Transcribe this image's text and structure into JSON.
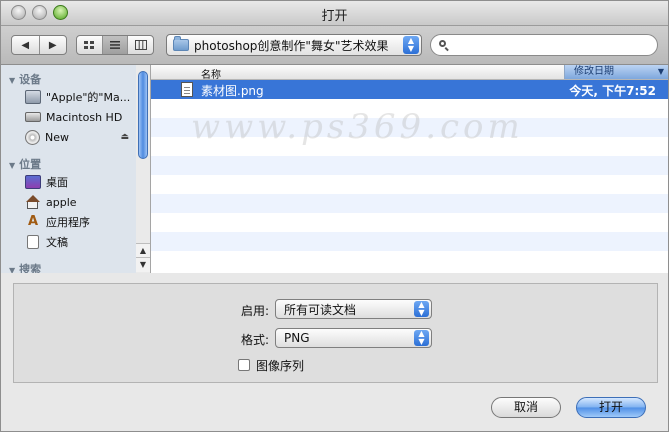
{
  "window": {
    "title": "打开"
  },
  "toolbar": {
    "back_icon": "◀",
    "forward_icon": "▶",
    "path_label": "photoshop创意制作\"舞女\"艺术效果",
    "search": {
      "value": "",
      "placeholder": ""
    }
  },
  "sidebar": {
    "groups": [
      {
        "label": "设备",
        "items": [
          {
            "label": "\"Apple\"的\"Ma...",
            "icon": "imac-icon"
          },
          {
            "label": "Macintosh HD",
            "icon": "hard-disk-icon"
          },
          {
            "label": "New",
            "icon": "disc-icon"
          }
        ]
      },
      {
        "label": "位置",
        "items": [
          {
            "label": "桌面",
            "icon": "desktop-icon"
          },
          {
            "label": "apple",
            "icon": "home-icon"
          },
          {
            "label": "应用程序",
            "icon": "applications-icon"
          },
          {
            "label": "文稿",
            "icon": "documents-icon"
          }
        ]
      },
      {
        "label": "搜索",
        "items": []
      }
    ],
    "eject_icon": "⏏"
  },
  "list": {
    "columns": {
      "name": "名称",
      "date": "修改日期"
    },
    "rows": [
      {
        "name": "素材图.png",
        "date": "今天, 下午7:52",
        "selected": true
      }
    ]
  },
  "options": {
    "enable_label": "启用:",
    "enable_value": "所有可读文档",
    "format_label": "格式:",
    "format_value": "PNG",
    "sequence_label": "图像序列"
  },
  "buttons": {
    "cancel": "取消",
    "open": "打开"
  },
  "watermark": "www.ps369.com",
  "colors": {
    "selection": "#3875d7",
    "stripe": "#edf3fe",
    "sidebar": "#dde4ec"
  }
}
